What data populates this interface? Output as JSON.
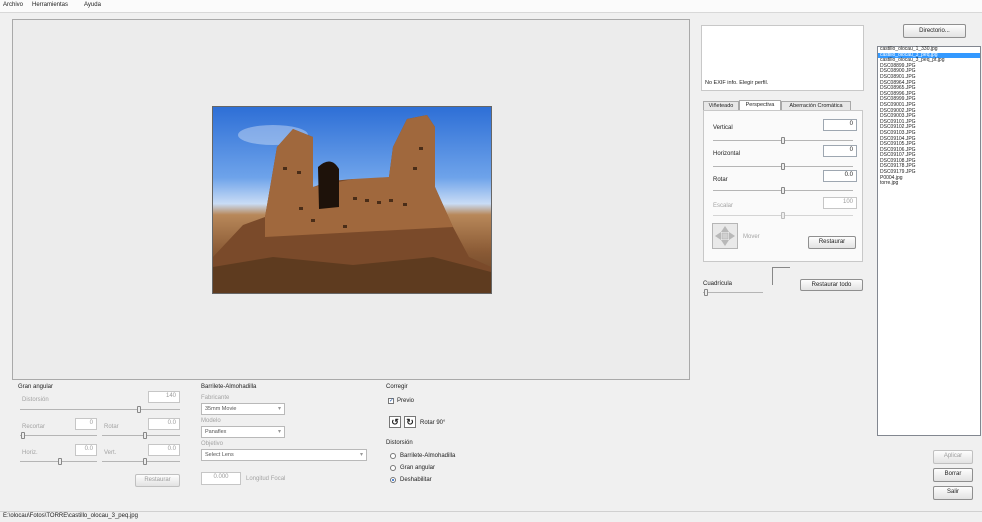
{
  "menu": [
    "Archivo",
    "Herramientas",
    "Ayuda"
  ],
  "exif_text": "No EXIF info. Elegir perfil.",
  "tabs": [
    "Viñeteado",
    "Perspectiva",
    "Aberración Cromática"
  ],
  "perspective": {
    "vertical": {
      "label": "Vertical",
      "value": "0"
    },
    "horizontal": {
      "label": "Horizontal",
      "value": "0"
    },
    "rotate": {
      "label": "Rotar",
      "value": "0.0"
    },
    "scale": {
      "label": "Escalar",
      "value": "100"
    },
    "move_label": "Mover",
    "restore_label": "Restaurar"
  },
  "grid": {
    "label": "Cuadrícula",
    "restore_all_label": "Restaurar todo"
  },
  "directory_button": "Directorio...",
  "files": [
    "castillo_olocau_1_330.jpg",
    "castillo_olocau_3_peq.jpg",
    "castillo_olocau_3_peq_pt.jpg",
    "DSC08899.JPG",
    "DSC08900.JPG",
    "DSC08901.JPG",
    "DSC08964.JPG",
    "DSC08965.JPG",
    "DSC08996.JPG",
    "DSC08999.JPG",
    "DSC09001.JPG",
    "DSC09002.JPG",
    "DSC09003.JPG",
    "DSC09101.JPG",
    "DSC09102.JPG",
    "DSC09103.JPG",
    "DSC09104.JPG",
    "DSC09105.JPG",
    "DSC09106.JPG",
    "DSC09107.JPG",
    "DSC09108.JPG",
    "DSC09178.JPG",
    "DSC09179.JPG",
    "P0004.jpg",
    "torre.jpg"
  ],
  "selected_file_index": 1,
  "side_buttons": {
    "apply": "Aplicar",
    "delete": "Borrar",
    "exit": "Salir"
  },
  "wide_angle": {
    "title": "Gran angular",
    "distortion": {
      "label": "Distorsión",
      "value": "140"
    },
    "crop": {
      "label": "Recortar",
      "value": "0"
    },
    "rotate": {
      "label": "Rotar",
      "value": "0.0"
    },
    "horiz": {
      "label": "Horiz.",
      "value": "0.0"
    },
    "vert": {
      "label": "Vert.",
      "value": "0.0"
    },
    "restore_label": "Restaurar"
  },
  "barrel": {
    "title": "Barrilete-Almohadilla",
    "maker_label": "Fabricante",
    "maker_value": "35mm Movie",
    "model_label": "Modelo",
    "model_value": "Panaflex",
    "lens_label": "Objetivo",
    "lens_value": "Select Lens",
    "focal_value": "0.000",
    "focal_label": "Longitud Focal"
  },
  "correct": {
    "title": "Corregir",
    "preview_label": "Previo",
    "preview_checked": true,
    "rotate_label": "Rotar 90°",
    "distortion_title": "Distorsión",
    "options": [
      "Barrilete-Almohadilla",
      "Gran angular",
      "Deshabilitar"
    ],
    "selected_option": 2
  },
  "status_path": "E:\\olocau\\Fotos\\TORRE\\castillo_olocau_3_peq.jpg",
  "icons": {
    "rotate_left": "rotate-left-icon",
    "rotate_right": "rotate-right-icon",
    "move": "move-arrows-icon"
  }
}
